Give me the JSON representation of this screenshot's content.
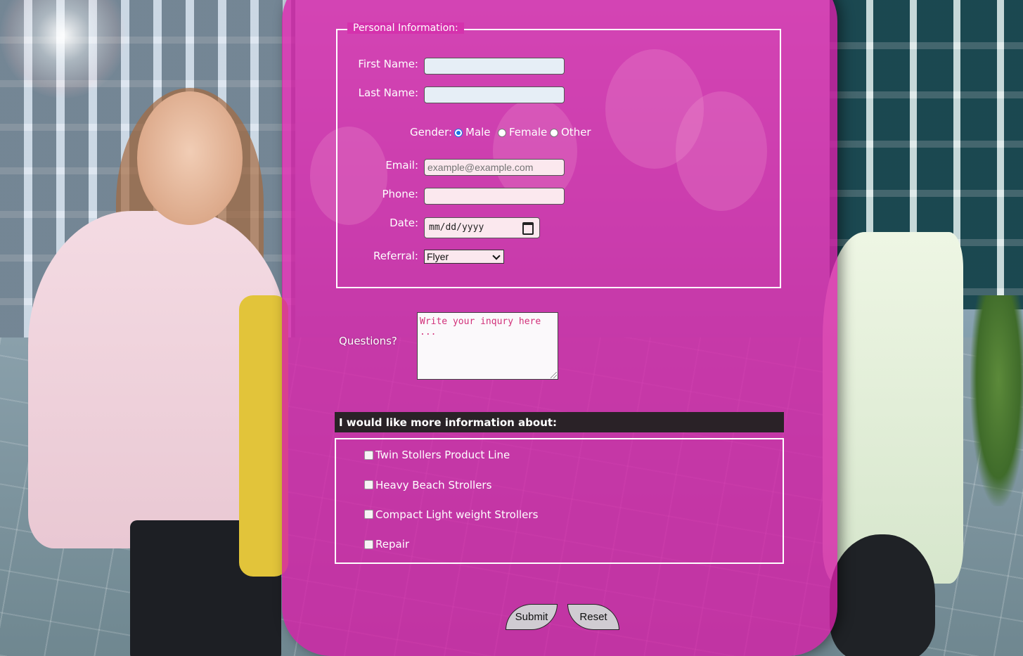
{
  "form": {
    "legend": "Personal Information:",
    "first_name_label": "First Name:",
    "first_name_value": "",
    "last_name_label": "Last Name:",
    "last_name_value": "",
    "gender_label": "Gender:",
    "gender_options": [
      "Male",
      "Female",
      "Other"
    ],
    "gender_selected": "Male",
    "email_label": "Email:",
    "email_placeholder": "example@example.com",
    "phone_label": "Phone:",
    "phone_value": "",
    "date_label": "Date:",
    "date_placeholder": "mm/dd/yyyy",
    "referral_label": "Referral:",
    "referral_selected": "Flyer",
    "questions_label": "Questions?",
    "questions_placeholder": "Write your inqury here ...",
    "more_info_heading": "I would like more information about:",
    "interests": [
      {
        "label": "Twin Stollers Product Line",
        "checked": false
      },
      {
        "label": "Heavy Beach Strollers",
        "checked": false
      },
      {
        "label": "Compact Light weight Strollers",
        "checked": false
      },
      {
        "label": "Repair",
        "checked": false
      }
    ],
    "submit_label": "Submit",
    "reset_label": "Reset"
  },
  "colors": {
    "panel": "#d61fa8",
    "heading_bar": "#2a2227",
    "radio_accent": "#1a73e8",
    "input_pink": "#fbe8ee",
    "placeholder": "#d2317a"
  }
}
